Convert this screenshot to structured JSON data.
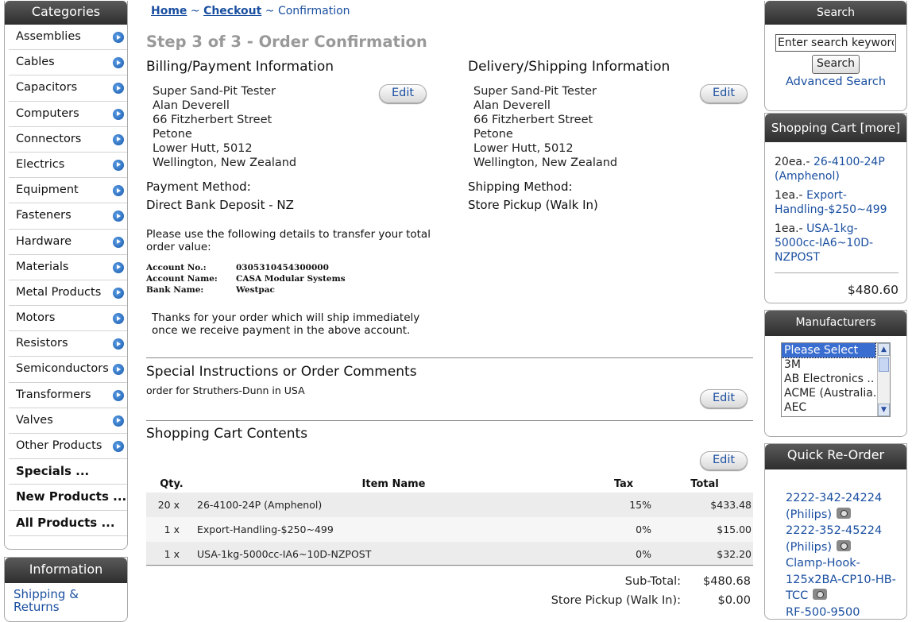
{
  "left": {
    "categories_title": "Categories",
    "categories": [
      "Assemblies",
      "Cables",
      "Capacitors",
      "Computers",
      "Connectors",
      "Electrics",
      "Equipment",
      "Fasteners",
      "Hardware",
      "Materials",
      "Metal Products",
      "Motors",
      "Resistors",
      "Semiconductors",
      "Transformers",
      "Valves",
      "Other Products"
    ],
    "specials": [
      "Specials ...",
      "New Products ...",
      "All Products ..."
    ],
    "information_title": "Information",
    "information_link": "Shipping & Returns"
  },
  "breadcrumb": {
    "home": "Home",
    "sep": "~",
    "checkout": "Checkout",
    "current": "Confirmation"
  },
  "page_title": "Step 3 of 3 - Order Confirmation",
  "billing": {
    "heading": "Billing/Payment Information",
    "address": [
      "Super Sand-Pit Tester",
      "Alan Deverell",
      "66 Fitzherbert Street",
      "Petone",
      "Lower Hutt, 5012",
      "Wellington, New Zealand"
    ],
    "edit": "Edit",
    "method_label": "Payment Method:",
    "method": "Direct Bank Deposit - NZ"
  },
  "delivery": {
    "heading": "Delivery/Shipping Information",
    "address": [
      "Super Sand-Pit Tester",
      "Alan Deverell",
      "66 Fitzherbert Street",
      "Petone",
      "Lower Hutt, 5012",
      "Wellington, New Zealand"
    ],
    "edit": "Edit",
    "method_label": "Shipping Method:",
    "method": "Store Pickup (Walk In)"
  },
  "bank": {
    "intro": "Please use the following details to transfer your total order value:",
    "account_no_label": "Account No.:",
    "account_no": "0305310454300000",
    "account_name_label": "Account Name:",
    "account_name": "CASA Modular Systems",
    "bank_name_label": "Bank Name:",
    "bank_name": "Westpac",
    "thanks": "Thanks for your order which will ship immediately once we receive payment in the above account."
  },
  "comments": {
    "heading": "Special Instructions or Order Comments",
    "text": "order for Struthers-Dunn in USA",
    "edit": "Edit"
  },
  "cart": {
    "heading": "Shopping Cart Contents",
    "edit": "Edit",
    "columns": {
      "qty": "Qty.",
      "name": "Item Name",
      "tax": "Tax",
      "total": "Total"
    },
    "rows": [
      {
        "qty": "20 x",
        "name": "26-4100-24P (Amphenol)",
        "tax": "15%",
        "total": "$433.48"
      },
      {
        "qty": "1 x",
        "name": "Export-Handling-$250~499",
        "tax": "0%",
        "total": "$15.00"
      },
      {
        "qty": "1 x",
        "name": "USA-1kg-5000cc-IA6~10D-NZPOST",
        "tax": "0%",
        "total": "$32.20"
      }
    ],
    "subtotal_label": "Sub-Total:",
    "subtotal": "$480.68",
    "shipping_label": "Store Pickup (Walk In):",
    "shipping": "$0.00"
  },
  "right": {
    "search_title": "Search",
    "search_placeholder": "Enter search keywords",
    "search_button": "Search",
    "advanced_search": "Advanced Search",
    "cart_title": "Shopping Cart",
    "cart_more": "[more]",
    "cart_items": [
      {
        "qty": "20ea.-",
        "name": "26-4100-24P (Amphenol)"
      },
      {
        "qty": "1ea.-",
        "name": "Export-Handling-$250~499"
      },
      {
        "qty": "1ea.-",
        "name": "USA-1kg-5000cc-IA6~10D-NZPOST"
      }
    ],
    "cart_total": "$480.60",
    "manufacturers_title": "Manufacturers",
    "manufacturers": [
      "Please Select",
      "3M",
      "AB Electronics ..",
      "ACME (Australia..",
      "AEC"
    ],
    "reorder_title": "Quick Re-Order",
    "reorder_items": [
      "2222-342-24224 (Philips)",
      "2222-352-45224 (Philips)",
      "Clamp-Hook-125x2BA-CP10-HB-TCC",
      "RF-500-9500"
    ]
  }
}
